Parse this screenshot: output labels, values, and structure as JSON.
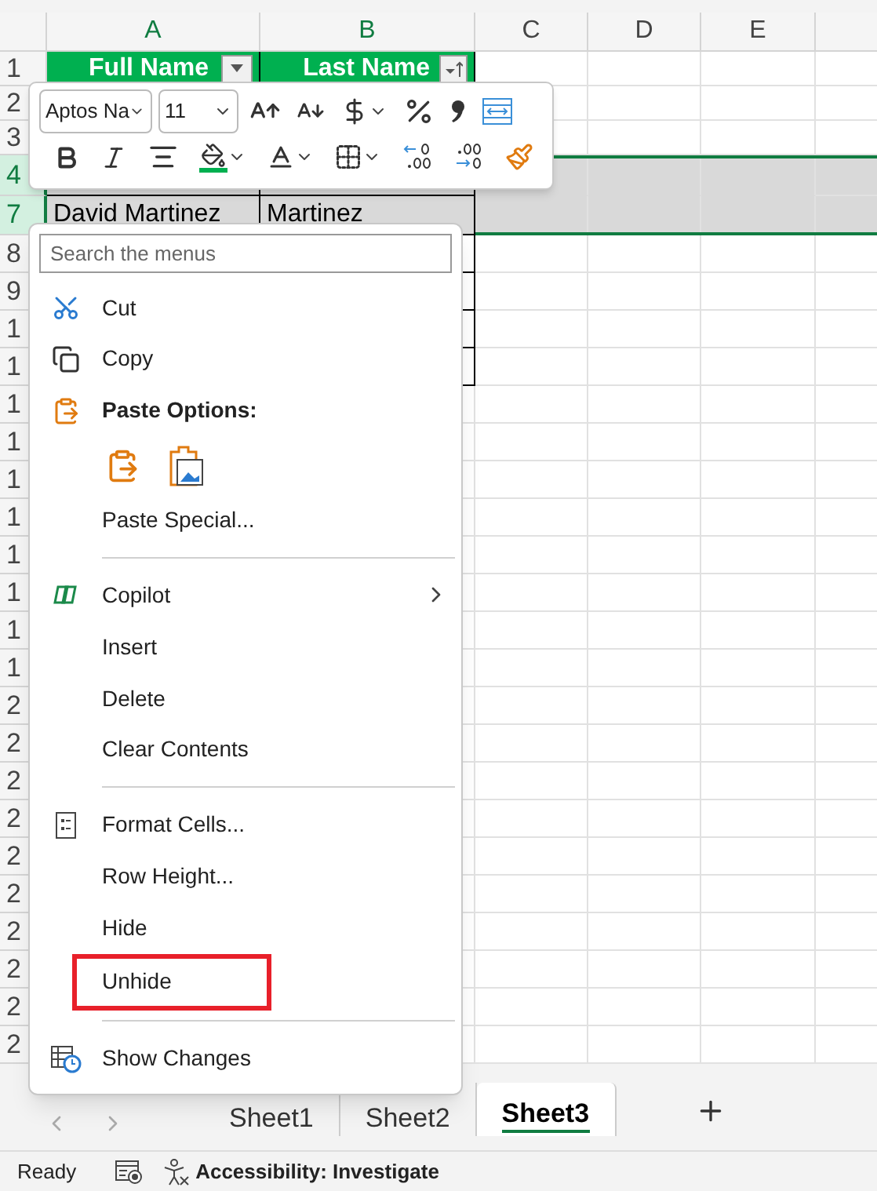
{
  "columns": [
    {
      "label": "A",
      "highlighted": true
    },
    {
      "label": "B",
      "highlighted": true
    },
    {
      "label": "C",
      "highlighted": false
    },
    {
      "label": "D",
      "highlighted": false
    },
    {
      "label": "E",
      "highlighted": false
    }
  ],
  "rows": [
    {
      "number": "1",
      "selected": false,
      "kind": "header",
      "cells": [
        "Full Name",
        "Last Name"
      ]
    },
    {
      "number": "2",
      "selected": false,
      "kind": "plain"
    },
    {
      "number": "3",
      "selected": false,
      "kind": "plain"
    },
    {
      "number": "4",
      "selected": true,
      "kind": "table"
    },
    {
      "number": "7",
      "selected": true,
      "kind": "table",
      "cells": [
        "David Martinez",
        "Martinez"
      ]
    },
    {
      "number": "8",
      "selected": false,
      "kind": "table"
    },
    {
      "number": "9",
      "selected": false,
      "kind": "table"
    },
    {
      "number": "1",
      "selected": false,
      "kind": "table"
    },
    {
      "number": "1",
      "selected": false,
      "kind": "table"
    },
    {
      "number": "1",
      "selected": false,
      "kind": "plain"
    },
    {
      "number": "1",
      "selected": false,
      "kind": "plain"
    },
    {
      "number": "1",
      "selected": false,
      "kind": "plain"
    },
    {
      "number": "1",
      "selected": false,
      "kind": "plain"
    },
    {
      "number": "1",
      "selected": false,
      "kind": "plain"
    },
    {
      "number": "1",
      "selected": false,
      "kind": "plain"
    },
    {
      "number": "1",
      "selected": false,
      "kind": "plain"
    },
    {
      "number": "1",
      "selected": false,
      "kind": "plain"
    },
    {
      "number": "2",
      "selected": false,
      "kind": "plain"
    },
    {
      "number": "2",
      "selected": false,
      "kind": "plain"
    },
    {
      "number": "2",
      "selected": false,
      "kind": "plain"
    },
    {
      "number": "2",
      "selected": false,
      "kind": "plain"
    },
    {
      "number": "2",
      "selected": false,
      "kind": "plain"
    },
    {
      "number": "2",
      "selected": false,
      "kind": "plain"
    },
    {
      "number": "2",
      "selected": false,
      "kind": "plain"
    },
    {
      "number": "2",
      "selected": false,
      "kind": "plain"
    },
    {
      "number": "2",
      "selected": false,
      "kind": "plain"
    },
    {
      "number": "2",
      "selected": false,
      "kind": "plain"
    }
  ],
  "mini_toolbar": {
    "font": "Aptos Na",
    "size": "11"
  },
  "context_menu": {
    "search": {
      "placeholder": "Search the menus"
    },
    "items": [
      {
        "kind": "item",
        "label": "Cut",
        "outlined": false
      },
      {
        "kind": "item",
        "label": "Copy",
        "outlined": false
      },
      {
        "kind": "header",
        "label": "Paste Options:",
        "outlined": false
      },
      {
        "kind": "paste_icons"
      },
      {
        "kind": "item",
        "label": "Paste Special...",
        "outlined": false
      },
      {
        "kind": "separator"
      },
      {
        "kind": "submenu",
        "label": "Copilot",
        "outlined": false
      },
      {
        "kind": "item",
        "label": "Insert",
        "outlined": false
      },
      {
        "kind": "item",
        "label": "Delete",
        "outlined": false
      },
      {
        "kind": "item",
        "label": "Clear Contents",
        "outlined": false
      },
      {
        "kind": "separator"
      },
      {
        "kind": "item",
        "label": "Format Cells...",
        "outlined": false
      },
      {
        "kind": "item",
        "label": "Row Height...",
        "outlined": false
      },
      {
        "kind": "item",
        "label": "Hide",
        "outlined": false
      },
      {
        "kind": "item",
        "label": "Unhide",
        "outlined": true
      },
      {
        "kind": "separator"
      },
      {
        "kind": "item",
        "label": "Show Changes",
        "outlined": false
      }
    ]
  },
  "sheet_tabs": [
    {
      "label": "Sheet1",
      "selected": false
    },
    {
      "label": "Sheet2",
      "selected": false
    },
    {
      "label": "Sheet3",
      "selected": true
    }
  ],
  "status_bar": {
    "mode": "Ready",
    "accessibility": "Accessibility: Investigate"
  }
}
